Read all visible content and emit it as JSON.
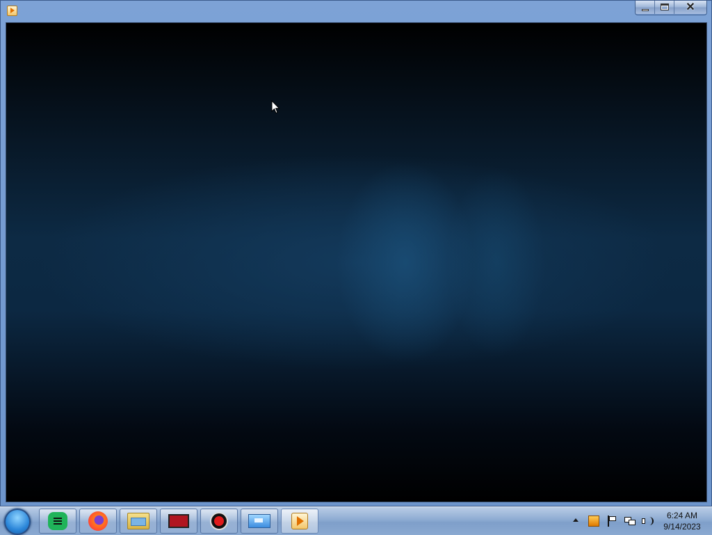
{
  "window": {
    "title": "",
    "app_icon": "media-player-icon",
    "buttons": {
      "minimize": "minimize-icon",
      "maximize": "maximize-icon",
      "close": "close-icon"
    }
  },
  "taskbar": {
    "start": "start-orb-icon",
    "apps": [
      {
        "name": "chat-app-icon"
      },
      {
        "name": "firefox-icon"
      },
      {
        "name": "file-explorer-icon"
      },
      {
        "name": "video-editor-icon"
      },
      {
        "name": "screen-recorder-icon"
      },
      {
        "name": "display-icon"
      },
      {
        "name": "media-player-icon",
        "active": true
      }
    ],
    "tray": {
      "icons": [
        "show-hidden-icons-arrow-icon",
        "tray-app-icon",
        "action-center-flag-icon",
        "network-icon",
        "volume-icon"
      ],
      "time": "6:24 AM",
      "date": "9/14/2023"
    }
  },
  "colors": {
    "titlebar": "#7da2d6",
    "taskbar": "#8eabd2",
    "content_background": "#0d2a44"
  }
}
